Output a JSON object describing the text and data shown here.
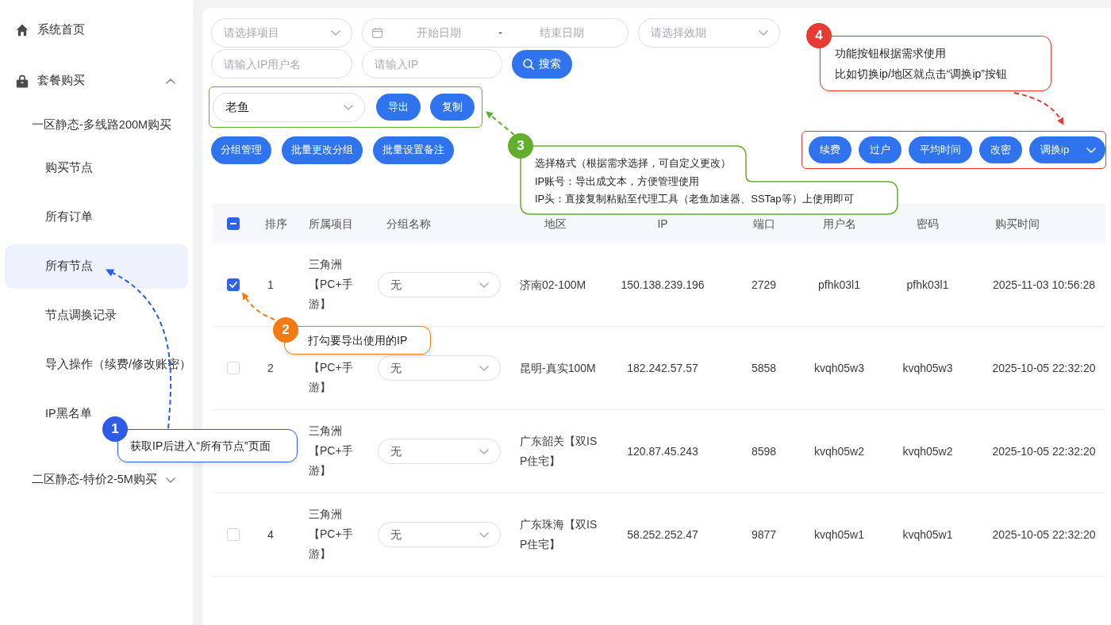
{
  "sidebar": {
    "menu": [
      {
        "label": "系统首页",
        "selected": false
      },
      {
        "label": "套餐购买",
        "expanded": true,
        "children": [
          {
            "label": "一区静态-多线路200M购买",
            "children": [
              {
                "label": "购买节点",
                "selected": false
              },
              {
                "label": "所有订单",
                "selected": false
              },
              {
                "label": "所有节点",
                "selected": true
              },
              {
                "label": "节点调换记录",
                "selected": false
              },
              {
                "label": "导入操作（续费/修改账密）",
                "selected": false
              },
              {
                "label": "IP黑名单",
                "selected": false
              }
            ]
          },
          {
            "label": "二区静态-特价2-5M购买",
            "expanded": false
          }
        ]
      }
    ]
  },
  "filters": {
    "project_select": {
      "placeholder": "请选择项目"
    },
    "date_range": {
      "start_placeholder": "开始日期",
      "separator": "-",
      "end_placeholder": "结束日期"
    },
    "validity_select": {
      "placeholder": "请选择效期"
    },
    "username_input": {
      "placeholder": "请输入IP用户名"
    },
    "ip_input": {
      "placeholder": "请输入IP"
    },
    "search_button": "搜索"
  },
  "export_bar": {
    "format_select": {
      "value": "老鱼"
    },
    "buttons": [
      "导出",
      "复制"
    ]
  },
  "group_buttons": [
    "分组管理",
    "批量更改分组",
    "批量设置备注"
  ],
  "action_buttons": [
    {
      "label": "续费",
      "kind": "button"
    },
    {
      "label": "过户",
      "kind": "button"
    },
    {
      "label": "平均时间",
      "kind": "button"
    },
    {
      "label": "改密",
      "kind": "button"
    },
    {
      "label": "调换ip",
      "kind": "dropdown"
    }
  ],
  "table": {
    "select_all": {
      "indeterminate": true
    },
    "columns": [
      "排序",
      "所属项目",
      "分组名称",
      "地区",
      "IP",
      "端口",
      "用户名",
      "密码",
      "购买时间"
    ],
    "rows": [
      {
        "checked": true,
        "rank": "1",
        "project": "三角洲【PC+手游】",
        "group": "无",
        "region": "济南02-100M",
        "ip": "150.138.239.196",
        "port": "2729",
        "username": "pfhk03l1",
        "password": "pfhk03l1",
        "purchase_time": "2025-11-03 10:56:28"
      },
      {
        "checked": false,
        "rank": "2",
        "project": "【PC+手游】",
        "group": "无",
        "region": "昆明-真实100M",
        "ip": "182.242.57.57",
        "port": "5858",
        "username": "kvqh05w3",
        "password": "kvqh05w3",
        "purchase_time": "2025-10-05 22:32:20"
      },
      {
        "project": "三角洲【PC+手游】",
        "group": "无",
        "region": "广东韶关【双ISP住宅】",
        "ip": "120.87.45.243",
        "port": "8598",
        "username": "kvqh05w2",
        "password": "kvqh05w2",
        "purchase_time": "2025-10-05 22:32:20"
      },
      {
        "checked": false,
        "rank": "4",
        "project": "三角洲【PC+手游】",
        "group": "无",
        "region": "广东珠海【双ISP住宅】",
        "ip": "58.252.252.47",
        "port": "9877",
        "username": "kvqh05w1",
        "password": "kvqh05w1",
        "purchase_time": "2025-10-05 22:32:20"
      }
    ]
  },
  "annotations": [
    {
      "number": "1",
      "color": "#2e5ce6",
      "lines": [
        "获取IP后进入“所有节点”页面"
      ]
    },
    {
      "number": "2",
      "color": "#f07b14",
      "lines": [
        "打勾要导出使用的IP"
      ]
    },
    {
      "number": "3",
      "color": "#62ae2f",
      "lines": [
        "选择格式（根据需求选择，可自定义更改）",
        "IP账号：导出成文本，方便管理使用",
        "IP头：直接复制粘贴至代理工具（老鱼加速器、SSTap等）上使用即可"
      ]
    },
    {
      "number": "4",
      "color": "#e63a33",
      "lines": [
        "功能按钮根据需求使用",
        "比如切换ip/地区就点击“调换ip”按钮"
      ]
    }
  ]
}
